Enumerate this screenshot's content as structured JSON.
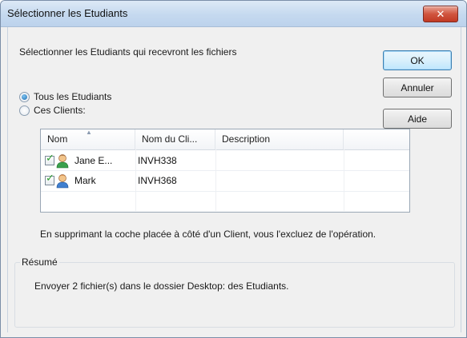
{
  "window": {
    "title": "Sélectionner les Etudiants",
    "close_glyph": "✕"
  },
  "dialog": {
    "instruction": "Sélectionner les Etudiants qui recevront les fichiers",
    "buttons": {
      "ok": "OK",
      "cancel": "Annuler",
      "help": "Aide"
    },
    "options": [
      {
        "label": "Tous les Etudiants",
        "selected": true
      },
      {
        "label": "Ces Clients:",
        "selected": false
      }
    ],
    "list": {
      "columns": [
        "Nom",
        "Nom du Cli...",
        "Description"
      ],
      "rows": [
        {
          "checked": true,
          "icon": "student-avatar-icon",
          "name": "Jane E...",
          "client_name": "INVH338",
          "description": ""
        },
        {
          "checked": true,
          "icon": "student-avatar-icon",
          "name": "Mark",
          "client_name": "INVH368",
          "description": ""
        }
      ]
    },
    "hint": "En supprimant la coche placée à côté d'un Client, vous l'excluez de l'opération.",
    "summary_label": "Résumé",
    "summary_text": "Envoyer 2 fichier(s) dans le dossier Desktop: des Etudiants."
  }
}
